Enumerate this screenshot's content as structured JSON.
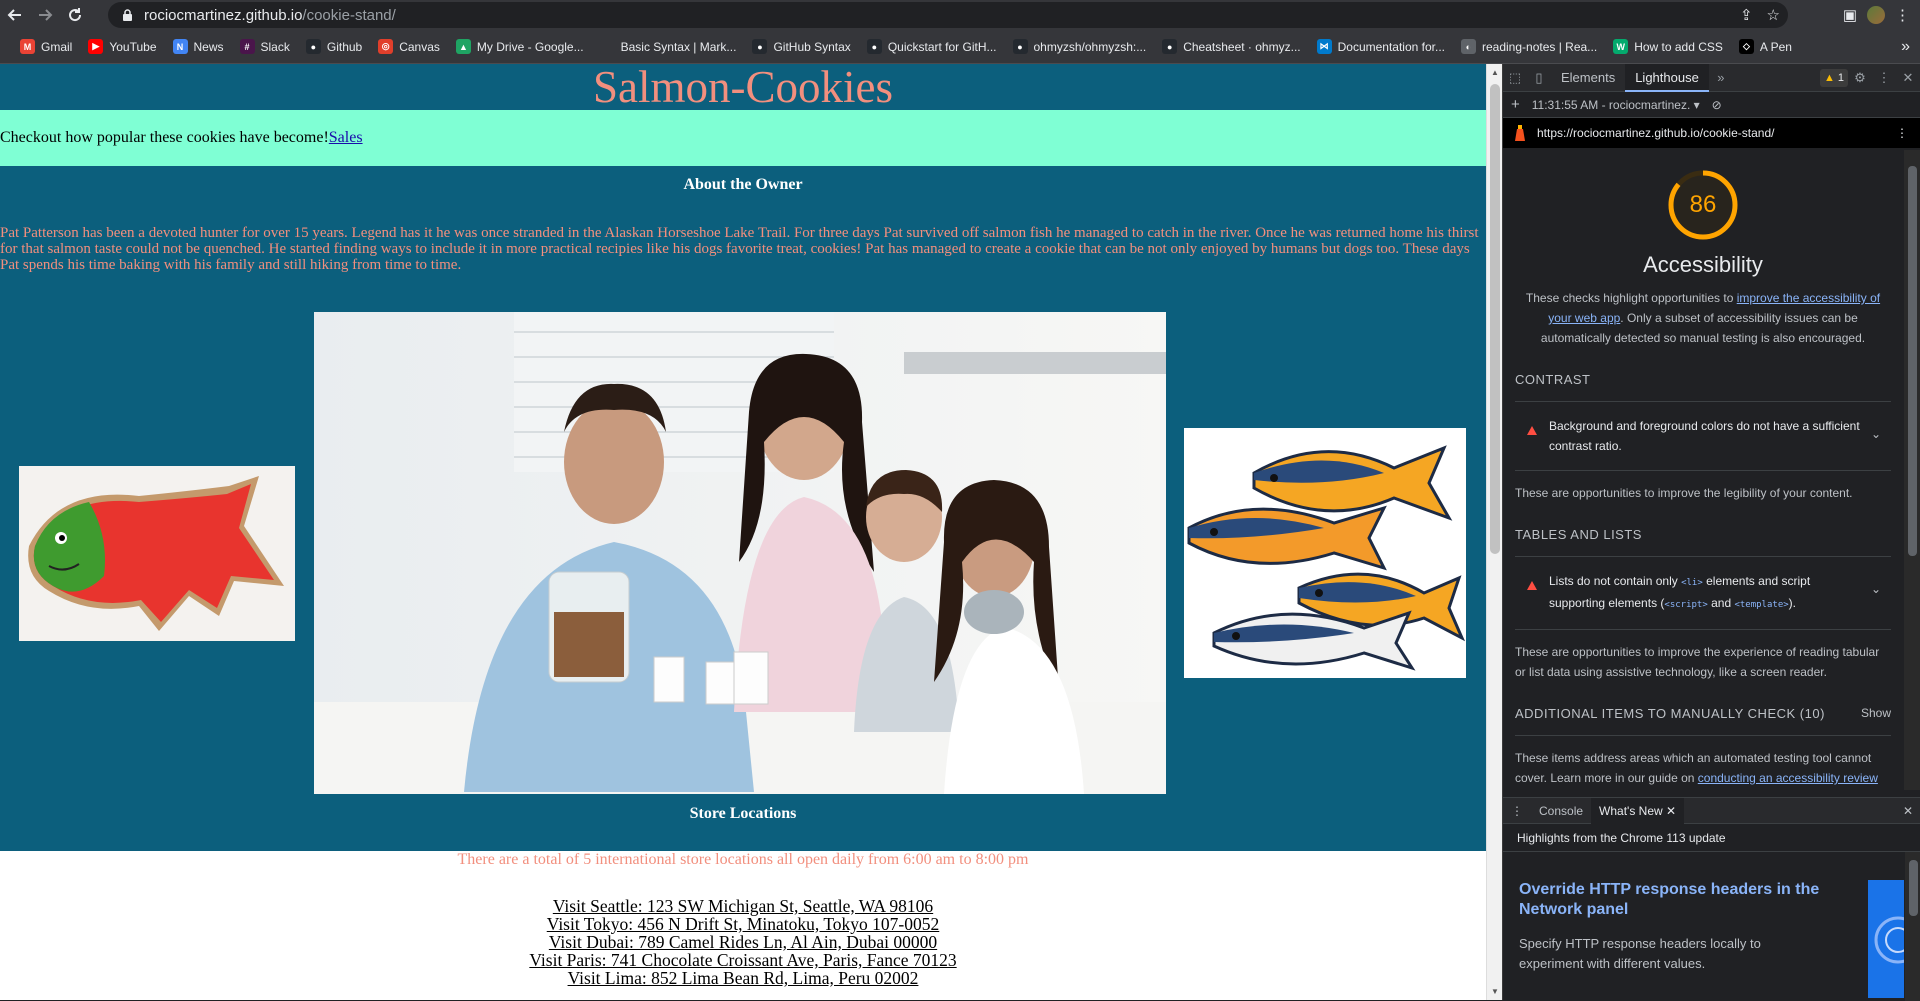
{
  "browser": {
    "url_host": "rociocmartinez.github.io",
    "url_path": "/cookie-stand/",
    "bookmarks": [
      {
        "label": "Gmail",
        "icon": "gmail-icon",
        "color": "#ea4335",
        "glyph": "M"
      },
      {
        "label": "YouTube",
        "icon": "youtube-icon",
        "color": "#ff0000",
        "glyph": "▶"
      },
      {
        "label": "News",
        "icon": "news-icon",
        "color": "#4285f4",
        "glyph": "N"
      },
      {
        "label": "Slack",
        "icon": "slack-icon",
        "color": "#4a154b",
        "glyph": "#"
      },
      {
        "label": "Github",
        "icon": "github-icon",
        "color": "#24292f",
        "glyph": "●"
      },
      {
        "label": "Canvas",
        "icon": "canvas-icon",
        "color": "#e13f2b",
        "glyph": "◎"
      },
      {
        "label": "My Drive - Google...",
        "icon": "drive-icon",
        "color": "#1fa463",
        "glyph": "▲"
      },
      {
        "label": "Basic Syntax | Mark...",
        "icon": "markdown-icon",
        "color": "#35363a",
        "glyph": ""
      },
      {
        "label": "GitHub Syntax",
        "icon": "github-icon",
        "color": "#24292f",
        "glyph": "●"
      },
      {
        "label": "Quickstart for GitH...",
        "icon": "github-icon",
        "color": "#24292f",
        "glyph": "●"
      },
      {
        "label": "ohmyzsh/ohmyzsh:...",
        "icon": "github-icon",
        "color": "#24292f",
        "glyph": "●"
      },
      {
        "label": "Cheatsheet · ohmyz...",
        "icon": "github-icon",
        "color": "#24292f",
        "glyph": "●"
      },
      {
        "label": "Documentation for...",
        "icon": "vscode-icon",
        "color": "#007acc",
        "glyph": "⋈"
      },
      {
        "label": "reading-notes | Rea...",
        "icon": "globe-icon",
        "color": "#5f6368",
        "glyph": "◐"
      },
      {
        "label": "How to add CSS",
        "icon": "w3schools-icon",
        "color": "#04aa6d",
        "glyph": "W"
      },
      {
        "label": "A Pen",
        "icon": "codepen-icon",
        "color": "#000000",
        "glyph": "◇"
      }
    ]
  },
  "site": {
    "title": "Salmon-Cookies",
    "banner_text": "Checkout how popular these cookies have become!",
    "banner_link": "Sales",
    "owner_heading": "About the Owner",
    "bio": "Pat Patterson has been a devoted hunter for over 15 years. Legend has it he was once stranded in the Alaskan Horseshoe Lake Trail. For three days Pat survived off salmon fish he managed to catch in the river. Once he was returned home his thirst for that salmon taste could not be quenched. He started finding ways to include it in more practical recipies like his dogs favorite treat, cookies! Pat has managed to create a cookie that can be not only enjoyed by humans but dogs too. These days Pat spends his time baking with his family and still hiking from time to time.",
    "stores_heading": "Store Locations",
    "stores_total": "There are a total of 5 international store locations all open daily from 6:00 am to 8:00 pm",
    "stores": [
      "Visit Seattle: 123 SW Michigan St, Seattle, WA 98106",
      "Visit Tokyo: 456 N Drift St, Minatoku, Tokyo 107-0052",
      "Visit Dubai: 789 Camel Rides Ln, Al Ain, Dubai 00000",
      "Visit Paris: 741 Chocolate Croissant Ave, Paris, Fance 70123",
      "Visit Lima: 852 Lima Bean Rd, Lima, Peru 02002"
    ],
    "colors": {
      "header_bg": "#0c5f7d",
      "banner_bg": "#7fffd4",
      "salmon": "#f28f7e"
    }
  },
  "devtools": {
    "tabs": [
      "Elements",
      "Lighthouse"
    ],
    "active_tab": "Lighthouse",
    "warning_count": "1",
    "report_time": "11:31:55 AM - rociocmartinez.",
    "report_url": "https://rociocmartinez.github.io/cookie-stand/",
    "score": "86",
    "score_value": 86,
    "category": "Accessibility",
    "desc_prefix": "These checks highlight opportunities to ",
    "desc_link": "improve the accessibility of your web app",
    "desc_suffix": ". Only a subset of accessibility issues can be automatically detected so manual testing is also encouraged.",
    "contrast_heading": "CONTRAST",
    "contrast_audit": "Background and foreground colors do not have a sufficient contrast ratio.",
    "contrast_note": "These are opportunities to improve the legibility of your content.",
    "tables_heading": "TABLES AND LISTS",
    "tables_audit_a": "Lists do not contain only ",
    "tables_code_li": "<li>",
    "tables_audit_b": " elements and script supporting elements (",
    "tables_code_script": "<script>",
    "tables_audit_c": " and ",
    "tables_code_template": "<template>",
    "tables_audit_d": ").",
    "tables_note": "These are opportunities to improve the experience of reading tabular or list data using assistive technology, like a screen reader.",
    "manual_heading": "ADDITIONAL ITEMS TO MANUALLY CHECK (10)",
    "manual_show": "Show",
    "manual_note_a": "These items address areas which an automated testing tool cannot cover. Learn more in our guide on ",
    "manual_note_link": "conducting an accessibility review",
    "drawer_tabs": [
      "Console",
      "What's New"
    ],
    "drawer_active": "What's New",
    "drawer_sub": "Highlights from the Chrome 113 update",
    "wn_title": "Override HTTP response headers in the Network panel",
    "wn_desc": "Specify HTTP response headers locally to experiment with different values."
  }
}
